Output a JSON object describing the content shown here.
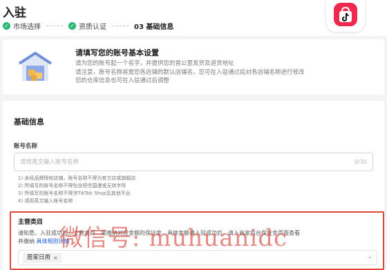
{
  "header": {
    "title": "入驻",
    "steps": [
      {
        "label": "市场选择",
        "status": "done"
      },
      {
        "label": "资质认证",
        "status": "done"
      },
      {
        "label": "03 基础信息",
        "status": "active"
      }
    ],
    "check_glyph": "✓"
  },
  "banner": {
    "title": "请填写您的账号基本设置",
    "lines": [
      "请为您的账号起一个名字，并提供您的首公里发货及退货地址",
      "请注意，账号名称将是您各店铺的默认店铺名，您可在入驻通过后对各店铺名称进行修改",
      "您的仓库信息也可在入驻通过后调整"
    ]
  },
  "form": {
    "section_title": "基础信息",
    "account_name": {
      "label": "账号名称",
      "placeholder": "请用英文输入账号名称",
      "value": "",
      "counter": "0/30"
    },
    "rules": [
      "1) 未经品牌授权店铺，账号名称不得为官方店或旗舰店",
      "2) 所填写的账号名称不得包含短信国漫或无效字符",
      "3) 所填写的账号名称不得涉TikTok Shop及其他平台",
      "4) 请用英文输入账号名称"
    ],
    "category": {
      "title": "主营类目",
      "desc_prefix": "请知悉，入驻成功后…主营类目…需缴纳对应金额的保证金，具体金额请入驻成功后，请入商家后台保证金页面查看",
      "desc_line2": "并缴纳",
      "link": "具体规则详情",
      "chip": "居家日用",
      "chip_close": "×",
      "chevron": "⌄"
    }
  },
  "watermark": "微信号: muhuanidc",
  "colors": {
    "accent_green": "#2bb673",
    "brand_red": "#ee2a4f",
    "highlight_border": "#e0453a",
    "link_blue": "#1a57d8"
  }
}
